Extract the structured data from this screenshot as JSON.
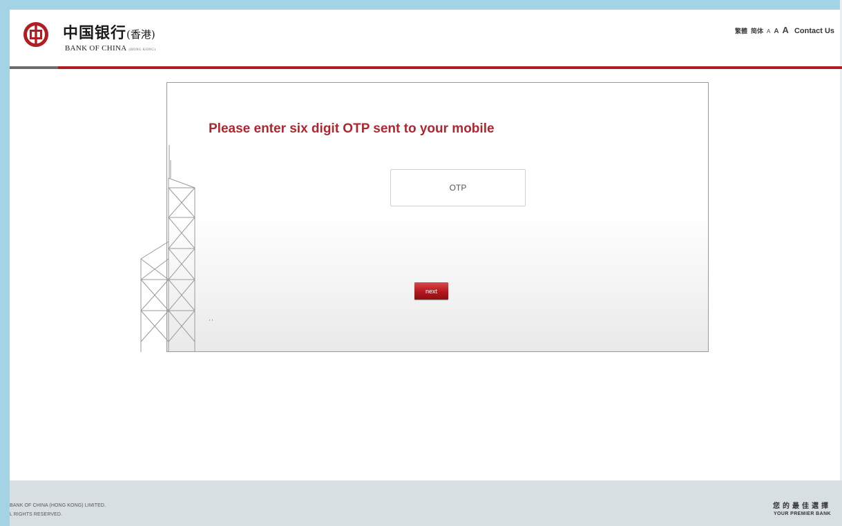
{
  "colors": {
    "brand_red": "#b01e24",
    "heading_red": "#b0262f",
    "frame_blue": "#a3d3e4",
    "footer_gray": "#d8dfe2"
  },
  "header": {
    "logo_cn": "中国银行",
    "logo_cn_region": "(香港)",
    "logo_en": "BANK OF CHINA",
    "logo_en_region": "(HONG KONG)",
    "logo_icon": "bank-of-china-logo-icon",
    "lang_traditional": "繁體",
    "lang_simplified": "简体",
    "font_small": "A",
    "font_medium": "A",
    "font_large": "A",
    "contact": "Contact Us"
  },
  "main": {
    "heading": "Please enter six digit OTP sent to your mobile",
    "otp_placeholder": "OTP",
    "next_label": "next",
    "mark": "' '",
    "illustration": "bank-tower-illustration"
  },
  "footer": {
    "copyright_line1": "BANK OF CHINA (HONG KONG) LIMITED.",
    "copyright_line2": "L RIGHTS RESERVED.",
    "slogan_cn": "您的最佳選擇",
    "slogan_en": "YOUR PREMIER BANK"
  }
}
